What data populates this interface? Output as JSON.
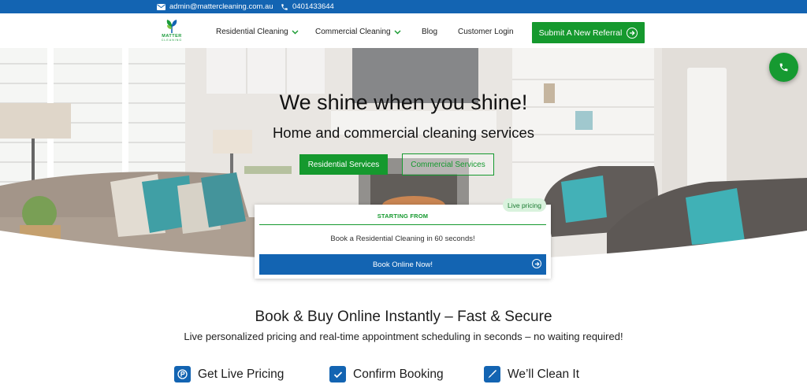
{
  "topbar": {
    "email": "admin@mattercleaning.com.au",
    "phone": "0401433644"
  },
  "logo": {
    "brand": "MATTER",
    "tagline": "CLEANING"
  },
  "nav": {
    "residential": "Residential Cleaning",
    "commercial": "Commercial Cleaning",
    "blog": "Blog",
    "login": "Customer Login",
    "referral": "Submit A New Referral"
  },
  "hero": {
    "title": "We shine when you shine!",
    "subtitle": "Home and commercial cleaning services",
    "btn_residential": "Residential Services",
    "btn_commercial": "Commercial Services"
  },
  "booking_card": {
    "badge": "Live pricing",
    "starting": "STARTING FROM",
    "text": "Book a Residential Cleaning in 60 seconds!",
    "button": "Book Online Now!"
  },
  "section": {
    "title": "Book & Buy Online Instantly – Fast & Secure",
    "subtitle": "Live personalized pricing and real-time appointment scheduling in seconds – no waiting required!",
    "steps": [
      {
        "label": "Get Live Pricing",
        "icon": "price-tag-icon"
      },
      {
        "label": "Confirm Booking",
        "icon": "checkmark-icon"
      },
      {
        "label": "We’ll Clean It",
        "icon": "broom-icon"
      }
    ]
  },
  "colors": {
    "brand_blue": "#1364b2",
    "brand_green": "#15992e"
  }
}
